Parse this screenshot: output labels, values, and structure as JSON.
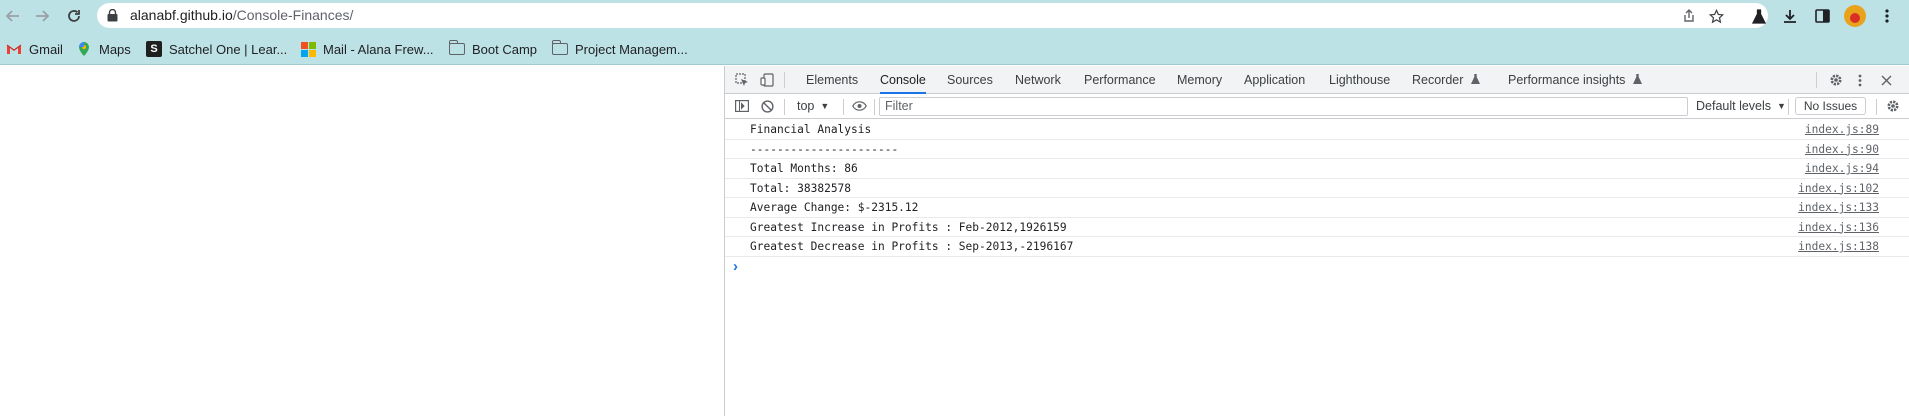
{
  "browser": {
    "url_host": "alanabf.github.io",
    "url_path": "/Console-Finances/",
    "bookmarks": [
      {
        "label": "Gmail",
        "icon": "gmail-icon"
      },
      {
        "label": "Maps",
        "icon": "maps-icon"
      },
      {
        "label": "Satchel One | Lear...",
        "icon": "satchel-icon"
      },
      {
        "label": "Mail - Alana Frew...",
        "icon": "microsoft-icon"
      },
      {
        "label": "Boot Camp",
        "icon": "folder-icon"
      },
      {
        "label": "Project Managem...",
        "icon": "folder-icon"
      }
    ]
  },
  "devtools": {
    "tabs": [
      "Elements",
      "Console",
      "Sources",
      "Network",
      "Performance",
      "Memory",
      "Application",
      "Lighthouse",
      "Recorder",
      "Performance insights"
    ],
    "active_tab": "Console",
    "context": "top",
    "filter_placeholder": "Filter",
    "levels": "Default levels",
    "issues": "No Issues"
  },
  "console": {
    "rows": [
      {
        "message": "Financial Analysis",
        "source": "index.js:89"
      },
      {
        "message": "----------------------",
        "source": "index.js:90"
      },
      {
        "message": "Total Months: 86",
        "source": "index.js:94"
      },
      {
        "message": "Total: 38382578",
        "source": "index.js:102"
      },
      {
        "message": "Average Change: $-2315.12",
        "source": "index.js:133"
      },
      {
        "message": "Greatest Increase in Profits : Feb-2012,1926159",
        "source": "index.js:136"
      },
      {
        "message": "Greatest Decrease in Profits : Sep-2013,-2196167",
        "source": "index.js:138"
      }
    ]
  },
  "colors": {
    "chrome_bg": "#bde2e6",
    "accent": "#1a73e8"
  }
}
